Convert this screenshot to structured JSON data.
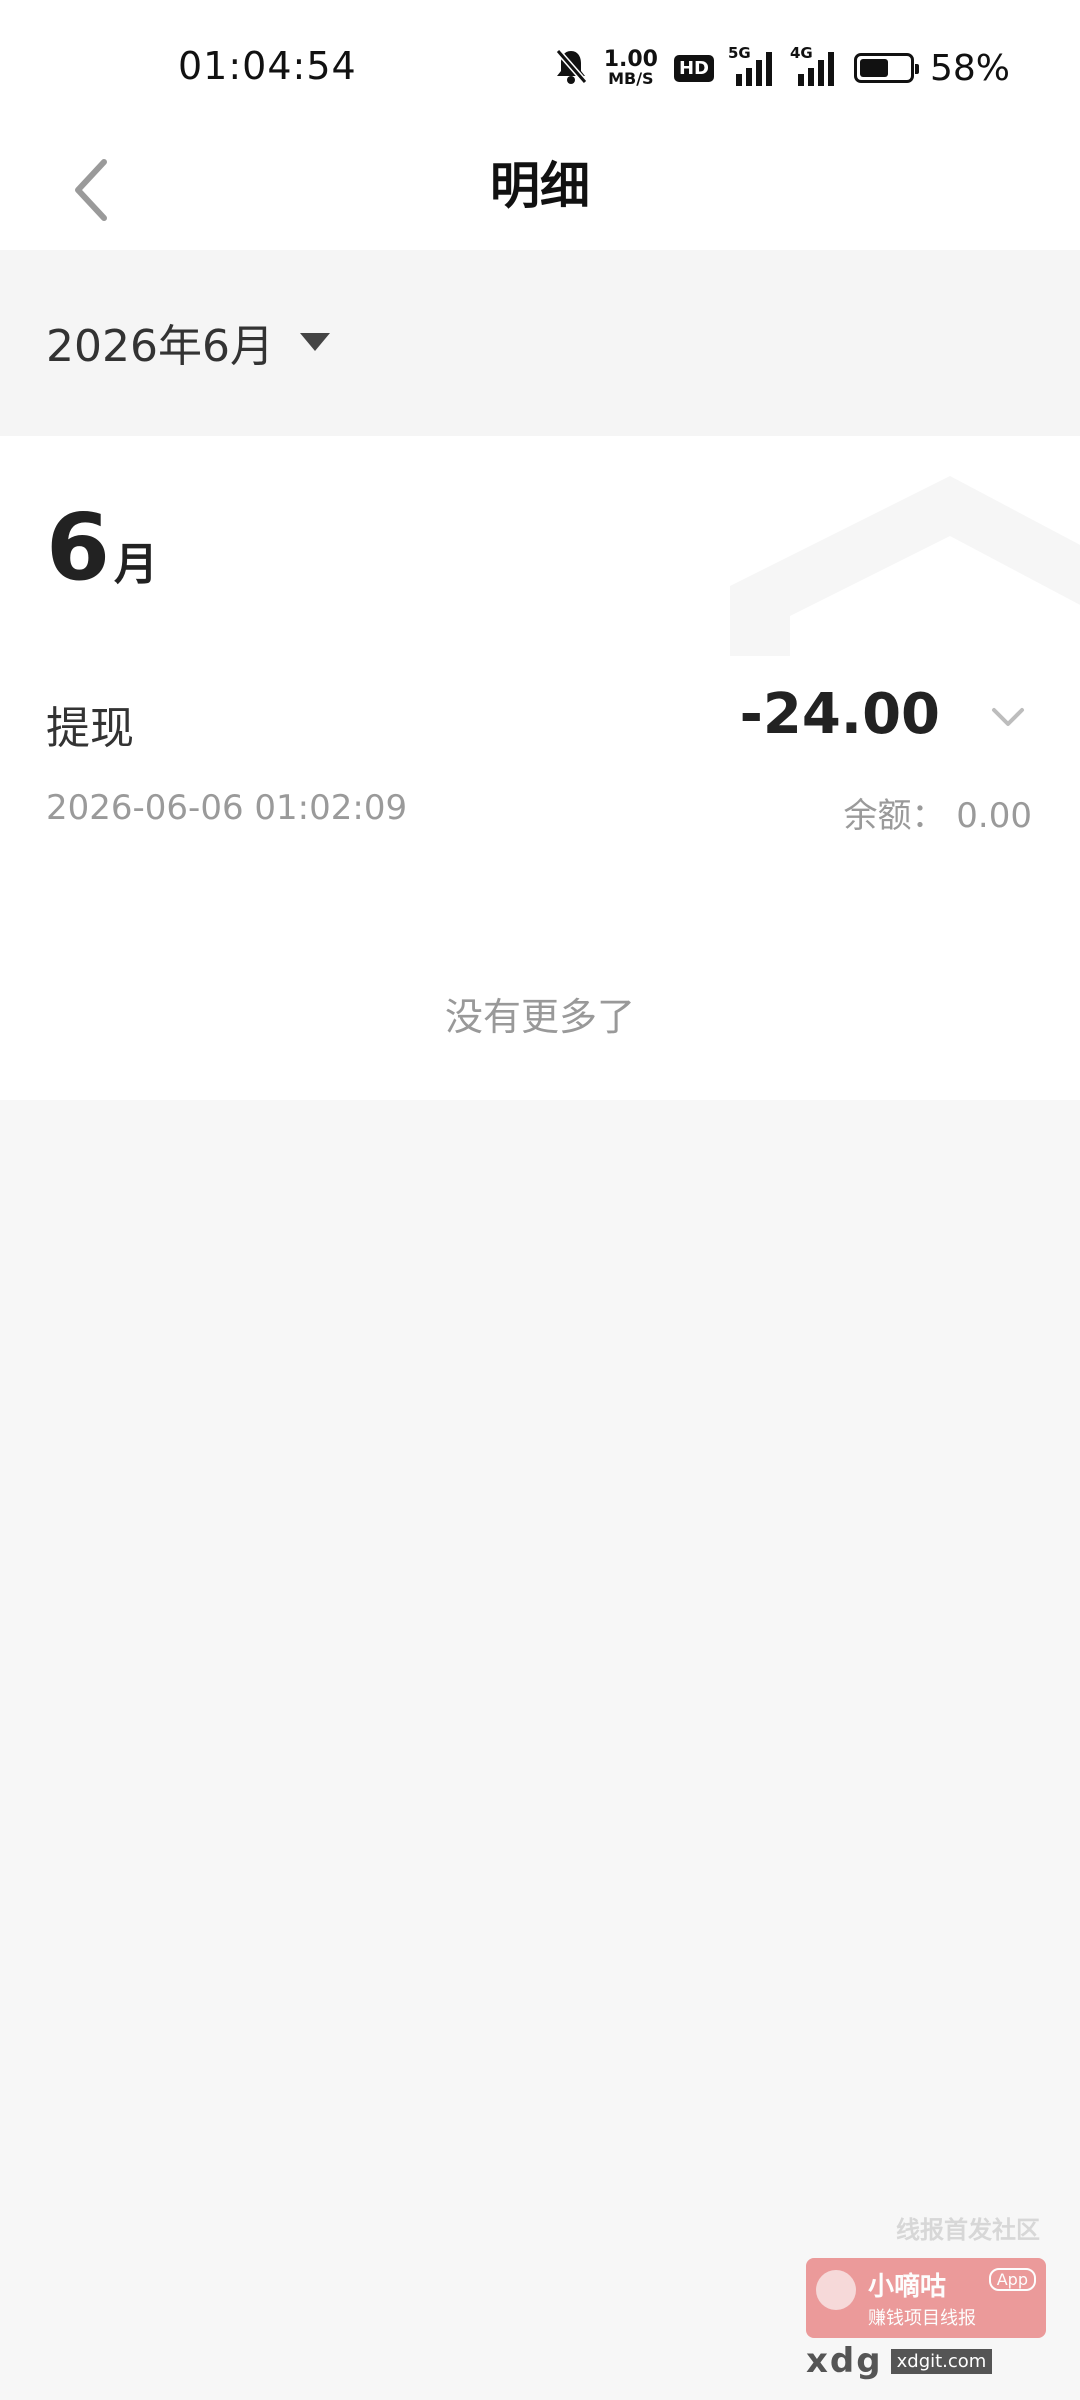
{
  "status_bar": {
    "time": "01:04:54",
    "net_speed_value": "1.00",
    "net_speed_unit": "MB/S",
    "hd_label": "HD",
    "signal1_label": "5G",
    "signal2_label": "4G",
    "battery_percent": "58%",
    "battery_level": 0.58
  },
  "header": {
    "title": "明细"
  },
  "filter": {
    "selected_month": "2026年6月"
  },
  "month_group": {
    "month_number": "6",
    "month_unit": "月"
  },
  "transactions": [
    {
      "title": "提现",
      "amount": "-24.00",
      "datetime": "2026-06-06 01:02:09",
      "balance": "余额： 0.00"
    }
  ],
  "list_footer": "没有更多了",
  "watermark": {
    "top_text": "线报首发社区",
    "name": "小嘀咕",
    "app_tag": "App",
    "subtitle": "赚钱项目线报",
    "brand": "xdg",
    "url": "xdgit.com"
  },
  "colors": {
    "background": "#f7f7f7",
    "card": "#ffffff",
    "text_primary": "#222222",
    "text_secondary": "#9a9a9a"
  }
}
